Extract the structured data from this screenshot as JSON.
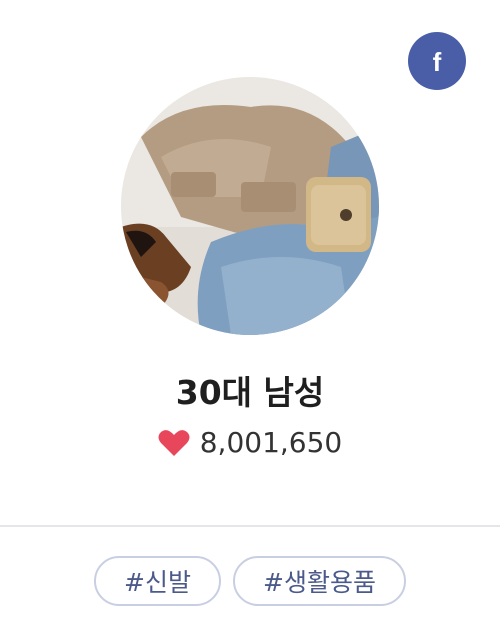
{
  "share": {
    "facebook_glyph": "f",
    "facebook_color": "#4a5ea8"
  },
  "profile": {
    "title": "30대 남성",
    "likes_count": "8,001,650",
    "heart_color": "#e8475b"
  },
  "tags": [
    "#신발",
    "#생활용품"
  ]
}
